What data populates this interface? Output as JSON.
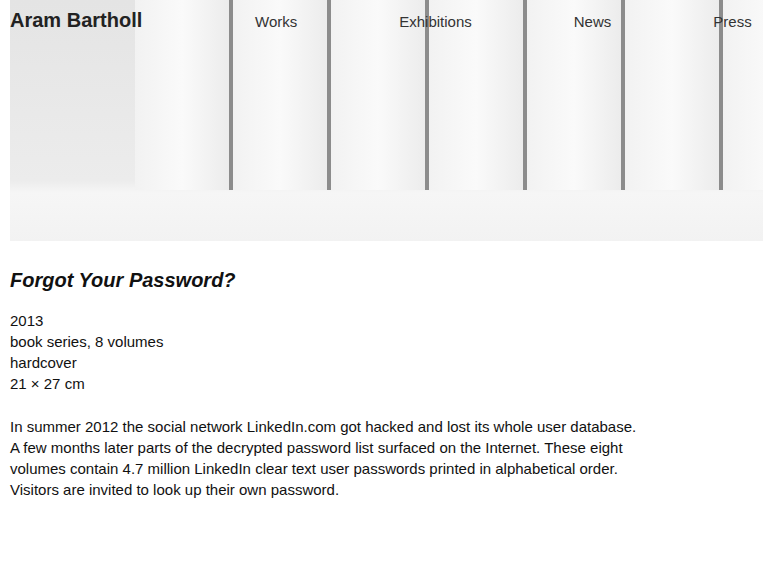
{
  "site": {
    "title": "Aram Bartholl"
  },
  "nav": [
    {
      "label": "Works"
    },
    {
      "label": "Exhibitions"
    },
    {
      "label": "News"
    },
    {
      "label": "Press"
    }
  ],
  "work": {
    "title": "Forgot Your Password?",
    "details": [
      "2013",
      "book series, 8 volumes",
      "hardcover",
      "21 × 27 cm"
    ],
    "description": [
      "In summer 2012 the social network LinkedIn.com got hacked and lost its whole user database.",
      "A few months later parts of the decrypted password list surfaced on the Internet. These eight",
      "volumes contain 4.7 million LinkedIn clear text user passwords printed in alphabetical order.",
      "Visitors are invited to look up their own password."
    ]
  }
}
